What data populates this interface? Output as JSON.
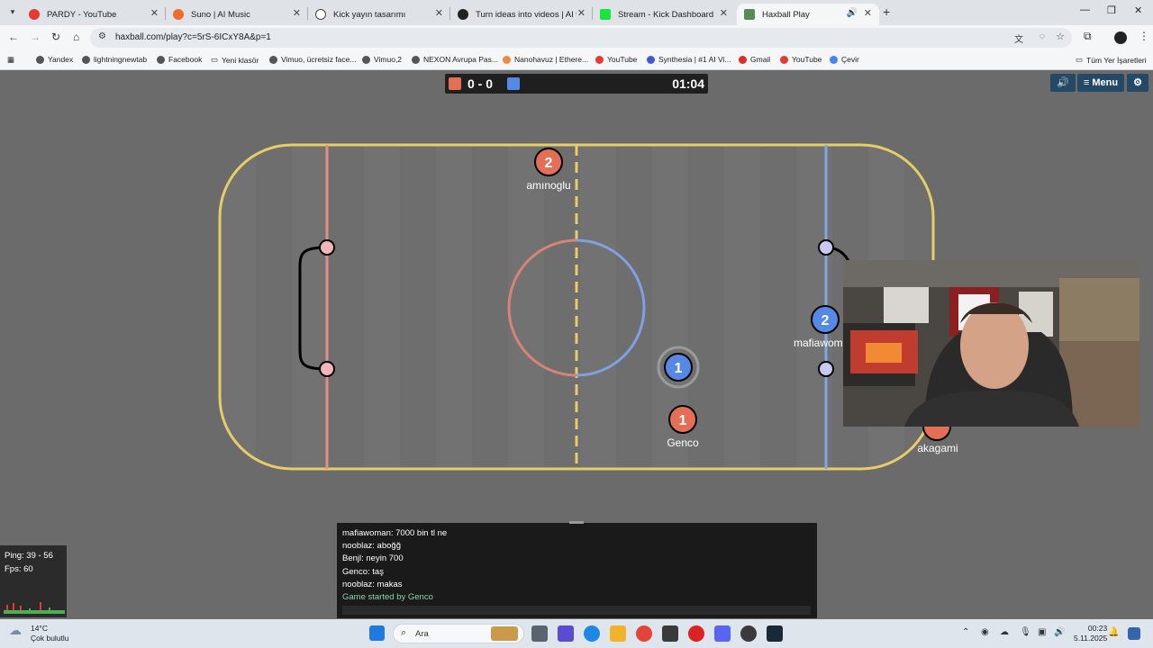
{
  "browser": {
    "tabs": [
      {
        "title": "PARDY - YouTube",
        "icon": "youtube-icon",
        "color": "#e53935"
      },
      {
        "title": "Suno | AI Music",
        "icon": "suno-icon",
        "color": "#f06c2a"
      },
      {
        "title": "Kick yayın tasarımı",
        "icon": "chatgpt-icon",
        "color": "#444444"
      },
      {
        "title": "Turn ideas into videos | AI video",
        "icon": "ai-video-icon",
        "color": "#222222"
      },
      {
        "title": "Stream - Kick Dashboard",
        "icon": "kick-icon",
        "color": "#19e63a"
      },
      {
        "title": "Haxball Play",
        "icon": "haxball-icon",
        "color": "#5c8a56"
      }
    ],
    "url": "haxball.com/play?c=5rS-6ICxY8A&p=1",
    "bookmarks": [
      "Yandex",
      "lightningnewtab",
      "Facebook",
      "Yeni klasör",
      "Vimuo, ücretsiz face...",
      "Vimuo,2",
      "NEXON Avrupa Pas...",
      "Nanohavuz | Ethere...",
      "YouTube",
      "Synthesia | #1 AI Vi...",
      "Gmail",
      "YouTube",
      "Çevir"
    ],
    "all_bookmarks": "Tüm Yer İşaretleri"
  },
  "game": {
    "score": "0 - 0",
    "time": "01:04",
    "menu_label": "Menu",
    "colors": {
      "red": "#e56e56",
      "blue": "#5689e5",
      "line": "#f1d86d"
    },
    "players": [
      {
        "number": "2",
        "name": "amınoglu",
        "team": "red"
      },
      {
        "number": "2",
        "name": "mafiawoman",
        "team": "blue"
      },
      {
        "number": "1",
        "name": "",
        "team": "blue"
      },
      {
        "number": "1",
        "name": "Genco",
        "team": "red"
      },
      {
        "number": "",
        "name": "akagami",
        "team": "red"
      }
    ]
  },
  "stats": {
    "ping": "Ping: 39 - 56",
    "fps": "Fps: 60"
  },
  "chat": {
    "messages": [
      "mafiawoman: 7000 bin tl ne",
      "nooblaz: aboğğ",
      "Benjl: neyin 700",
      "Genco: taş",
      "nooblaz: makas"
    ],
    "system": "Game started by Genco"
  },
  "taskbar": {
    "search_placeholder": "Ara",
    "weather_temp": "14°C",
    "weather_desc": "Çok bulutlu",
    "time": "00:23",
    "date": "5.11.2025"
  }
}
